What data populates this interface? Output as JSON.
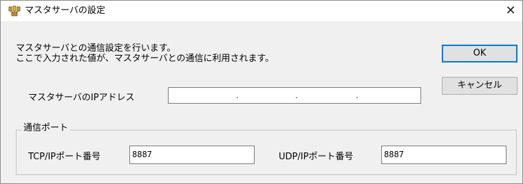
{
  "window": {
    "title": "マスタサーバの設定",
    "close_symbol": "✕"
  },
  "description": {
    "line1": "マスタサーバとの通信設定を行います。",
    "line2": "ここで入力された値が、マスタサーバとの通信に利用されます。"
  },
  "buttons": {
    "ok": "OK",
    "cancel": "キャンセル"
  },
  "ip": {
    "label": "マスタサーバのIPアドレス",
    "separators": [
      ".",
      ".",
      "."
    ],
    "octets": [
      "",
      "",
      "",
      ""
    ]
  },
  "comm_port": {
    "title": "通信ポート",
    "tcp_label": "TCP/IPポート番号",
    "tcp_value": "8887",
    "udp_label": "UDP/IPポート番号",
    "udp_value": "8887"
  },
  "icons": {
    "app": "network-computers-icon",
    "close": "close-icon"
  },
  "colors": {
    "titlebar": "#ffffff",
    "dialog_bg": "#f0f0f0",
    "default_button_border": "#0078d7"
  }
}
